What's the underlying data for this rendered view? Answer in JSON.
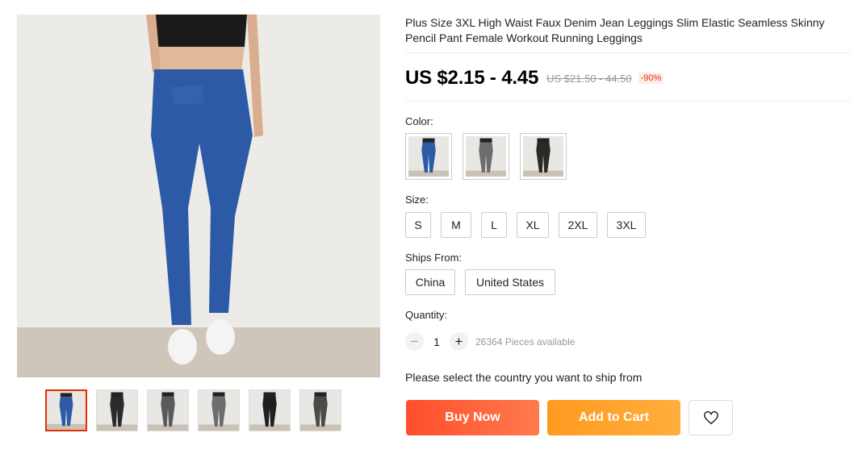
{
  "product": {
    "title": "Plus Size 3XL High Waist Faux Denim Jean Leggings Slim Elastic Seamless Skinny Pencil Pant Female Workout Running Leggings",
    "price": "US $2.15 - 4.45",
    "original_price": "US $21.50 - 44.50",
    "discount": "-90%"
  },
  "gallery": {
    "main_image_icon": "blue-leggings-model-photo",
    "thumbnails": [
      {
        "icon": "blue-leggings-thumb",
        "active": true
      },
      {
        "icon": "black-leggings-back-thumb",
        "active": false
      },
      {
        "icon": "leggings-closeup-thumb",
        "active": false
      },
      {
        "icon": "grey-leggings-thumb",
        "active": false
      },
      {
        "icon": "black-leggings-front-thumb",
        "active": false
      },
      {
        "icon": "grey-leggings-flatlay-thumb",
        "active": false
      }
    ]
  },
  "color": {
    "label": "Color:",
    "options": [
      {
        "icon": "blue-leggings-swatch",
        "color": "#2b5aa8"
      },
      {
        "icon": "grey-leggings-swatch",
        "color": "#6d6d6d"
      },
      {
        "icon": "black-leggings-swatch",
        "color": "#2a2a2a"
      }
    ]
  },
  "size": {
    "label": "Size:",
    "options": [
      "S",
      "M",
      "L",
      "XL",
      "2XL",
      "3XL"
    ]
  },
  "ships_from": {
    "label": "Ships From:",
    "options": [
      "China",
      "United States"
    ]
  },
  "quantity": {
    "label": "Quantity:",
    "value": "1",
    "minus": "−",
    "plus": "+",
    "available": "26364 Pieces available"
  },
  "notice": "Please select the country you want to ship from",
  "actions": {
    "buy_now": "Buy Now",
    "add_to_cart": "Add to Cart",
    "wishlist_icon": "heart-icon"
  },
  "colors": {
    "accent_red": "#e62e04",
    "buy_gradient": [
      "#ff4e2b",
      "#ff7a4d"
    ],
    "cart_gradient": [
      "#ff9a1f",
      "#ffae3d"
    ]
  }
}
